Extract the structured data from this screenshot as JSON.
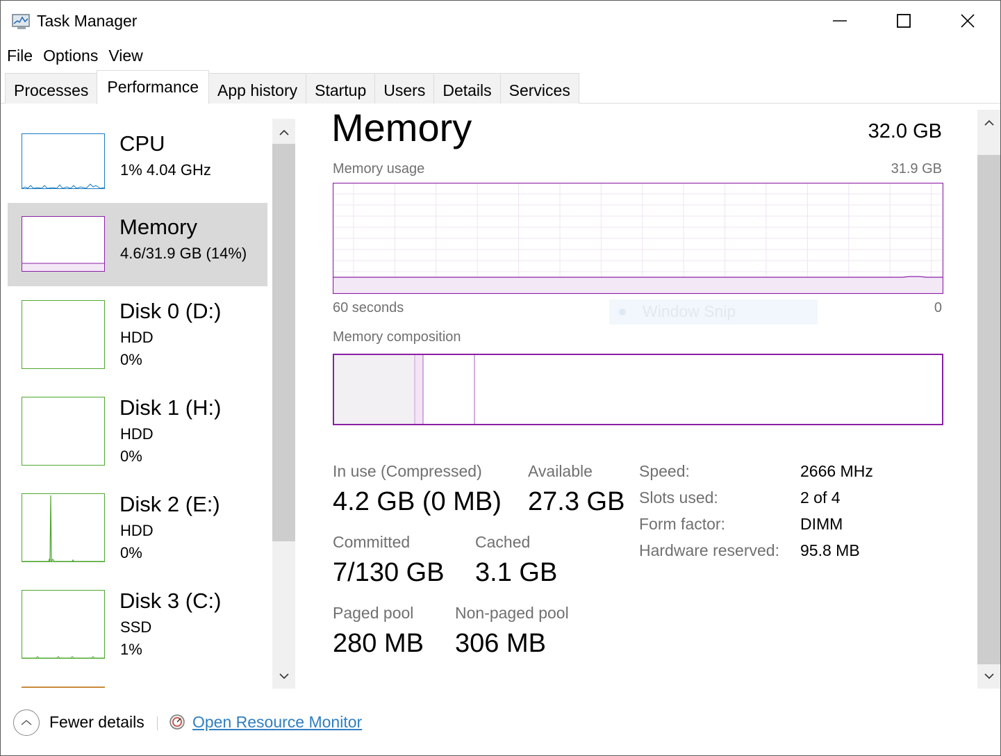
{
  "window": {
    "title": "Task Manager",
    "controls": {
      "minimize": "minimize",
      "maximize": "maximize",
      "close": "close"
    }
  },
  "menu": [
    "File",
    "Options",
    "View"
  ],
  "tabs": [
    {
      "label": "Processes",
      "active": false
    },
    {
      "label": "Performance",
      "active": true
    },
    {
      "label": "App history",
      "active": false
    },
    {
      "label": "Startup",
      "active": false
    },
    {
      "label": "Users",
      "active": false
    },
    {
      "label": "Details",
      "active": false
    },
    {
      "label": "Services",
      "active": false
    }
  ],
  "sidebar": {
    "items": [
      {
        "title": "CPU",
        "line1": "1%  4.04 GHz",
        "line2": "",
        "color": "#1a7ac0",
        "selected": false
      },
      {
        "title": "Memory",
        "line1": "4.6/31.9 GB (14%)",
        "line2": "",
        "color": "#8b1fa6",
        "selected": true
      },
      {
        "title": "Disk 0 (D:)",
        "line1": "HDD",
        "line2": "0%",
        "color": "#4ea72e",
        "selected": false
      },
      {
        "title": "Disk 1 (H:)",
        "line1": "HDD",
        "line2": "0%",
        "color": "#4ea72e",
        "selected": false
      },
      {
        "title": "Disk 2 (E:)",
        "line1": "HDD",
        "line2": "0%",
        "color": "#4ea72e",
        "selected": false
      },
      {
        "title": "Disk 3 (C:)",
        "line1": "SSD",
        "line2": "1%",
        "color": "#4ea72e",
        "selected": false
      }
    ]
  },
  "main": {
    "heading": "Memory",
    "total": "32.0 GB",
    "usage_label": "Memory usage",
    "usage_max": "31.9 GB",
    "time_left": "60 seconds",
    "time_right": "0",
    "composition_label": "Memory composition",
    "accent": "#8b1fa6",
    "stats": {
      "in_use_label": "In use (Compressed)",
      "in_use_value": "4.2 GB (0 MB)",
      "available_label": "Available",
      "available_value": "27.3 GB",
      "committed_label": "Committed",
      "committed_value": "7/130 GB",
      "cached_label": "Cached",
      "cached_value": "3.1 GB",
      "paged_label": "Paged pool",
      "paged_value": "280 MB",
      "nonpaged_label": "Non-paged pool",
      "nonpaged_value": "306 MB"
    },
    "details": {
      "speed_label": "Speed:",
      "speed_value": "2666 MHz",
      "slots_label": "Slots used:",
      "slots_value": "2 of 4",
      "form_label": "Form factor:",
      "form_value": "DIMM",
      "hw_label": "Hardware reserved:",
      "hw_value": "95.8 MB"
    }
  },
  "overlay": {
    "snip_text": "Window Snip"
  },
  "footer": {
    "fewer_details": "Fewer details",
    "resource_monitor": "Open Resource Monitor"
  }
}
